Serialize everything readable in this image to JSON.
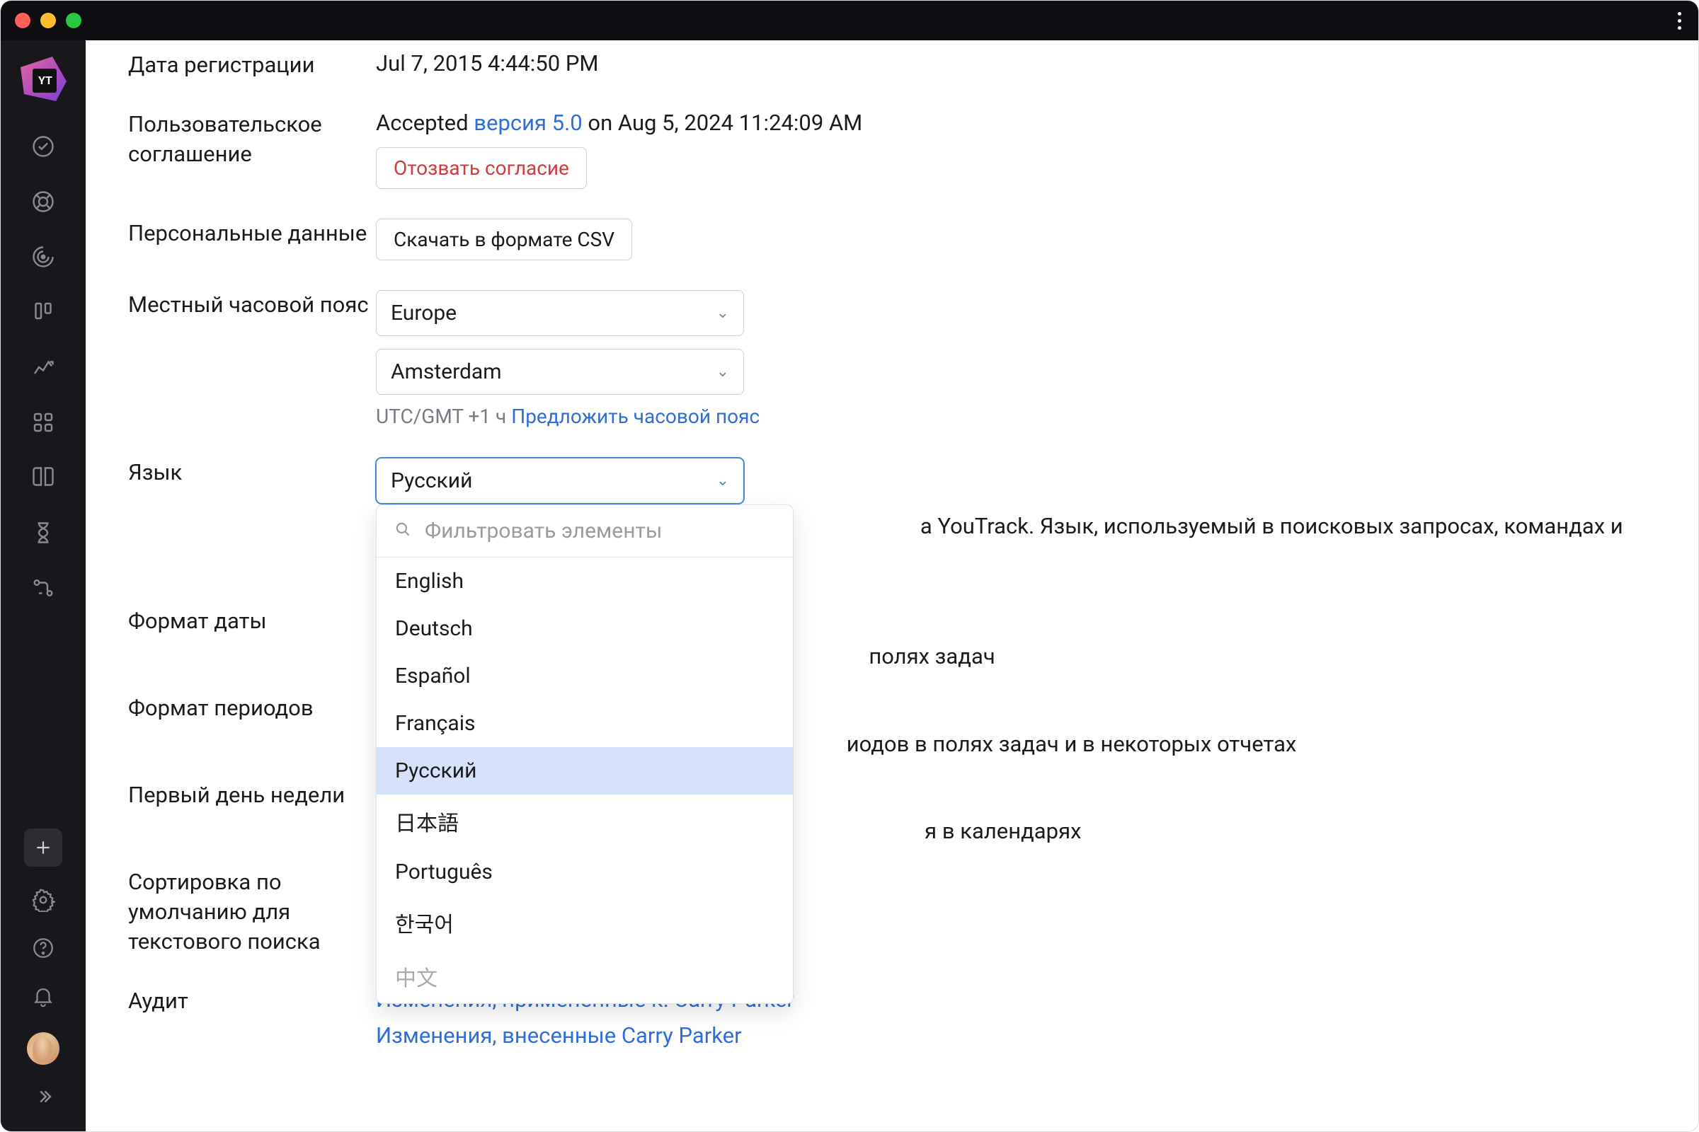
{
  "titlebar": {},
  "sidebar": {
    "items": [
      {
        "name": "tasks-icon"
      },
      {
        "name": "life-ring-icon"
      },
      {
        "name": "activity-icon"
      },
      {
        "name": "board-icon"
      },
      {
        "name": "chart-icon"
      },
      {
        "name": "apps-icon"
      },
      {
        "name": "book-icon"
      },
      {
        "name": "hourglass-icon"
      },
      {
        "name": "flow-icon"
      }
    ],
    "bottom": {
      "add": "+"
    }
  },
  "form": {
    "registration": {
      "label": "Дата регистрации",
      "value": "Jul 7, 2015 4:44:50 PM"
    },
    "agreement": {
      "label": "Пользовательское соглашение",
      "accepted_prefix": "Accepted ",
      "version_link": "версия 5.0",
      "accepted_suffix": " on Aug 5, 2024 11:24:09 AM",
      "revoke_btn": "Отозвать согласие"
    },
    "personal": {
      "label": "Персональные данные",
      "csv_btn": "Скачать в формате CSV"
    },
    "timezone": {
      "label": "Местный часовой пояс",
      "region": "Europe",
      "city": "Amsterdam",
      "hint_prefix": "UTC/GMT +1 ч ",
      "hint_link": "Предложить часовой пояс"
    },
    "language": {
      "label": "Язык",
      "value": "Русский",
      "filter_placeholder": "Фильтровать элементы",
      "options": [
        "English",
        "Deutsch",
        "Español",
        "Français",
        "Русский",
        "日本語",
        "Português",
        "한국어",
        "中文"
      ],
      "desc_fragment": "а YouTrack. Язык, используемый в поисковых запросах, командах и настраиваемых"
    },
    "date_format": {
      "label": "Формат даты",
      "desc_fragment": "полях задач"
    },
    "period_format": {
      "label": "Формат периодов",
      "desc_fragment": "иодов в полях задач и в некоторых отчетах"
    },
    "first_day": {
      "label": "Первый день недели",
      "desc_fragment": "я в календарях"
    },
    "sort": {
      "label": "Сортировка по умолчанию для текстового поиска"
    },
    "audit": {
      "label": "Аудит",
      "link1": "Изменения, примененные к: Carry Parker",
      "link2": "Изменения, внесенные Carry Parker"
    }
  }
}
